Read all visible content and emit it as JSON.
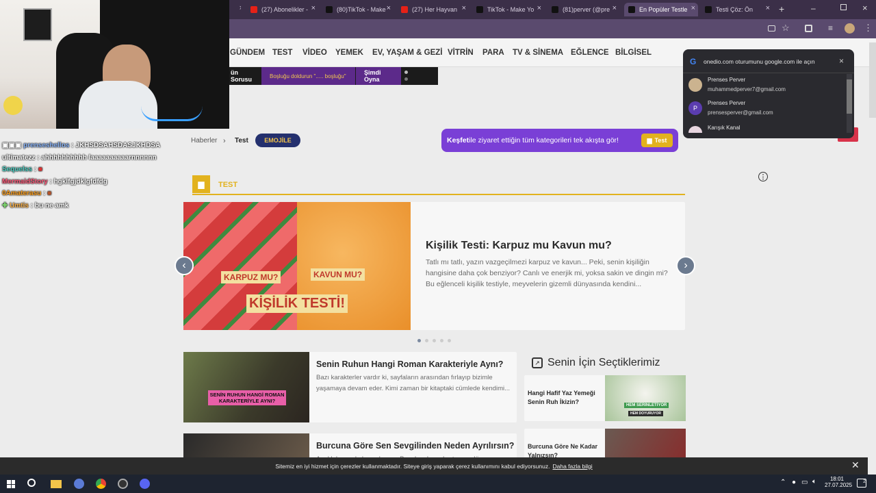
{
  "tabs": [
    {
      "label": "(27) Abonelikler -",
      "icon_color": "#e62117"
    },
    {
      "label": "(80)TikTok - Make",
      "icon_color": "#111111"
    },
    {
      "label": "(27) Her Hayvan",
      "icon_color": "#e62117"
    },
    {
      "label": "TikTok - Make Yo",
      "icon_color": "#111111"
    },
    {
      "label": "(81)perver (@pre",
      "icon_color": "#111111"
    },
    {
      "label": "En Popüler Testle",
      "icon_color": "#111111"
    },
    {
      "label": "Testi Çöz: Ön",
      "icon_color": "#111111"
    }
  ],
  "nav": {
    "items": [
      "GÜNDEM",
      "TEST",
      "VİDEO",
      "YEMEK",
      "EV, YAŞAM & GEZİ",
      "VİTRİN",
      "PARA",
      "TV & SİNEMA",
      "EĞLENCE",
      "BİLGİSEL"
    ]
  },
  "subbar": {
    "item1": "ün Sorusu",
    "item2": "Boşluğu doldurun \"..... boşluğu\"",
    "item3": "Şimdi Oyna"
  },
  "breadcrumb": {
    "home": "Haberler",
    "current": "Test",
    "badge": "EMOJİLE"
  },
  "promo": {
    "bold": "Keşfet",
    "rest": " ile ziyaret ettiğin tüm kategorileri tek akışta gör!",
    "button": "Test"
  },
  "section": {
    "label": "TEST"
  },
  "hero": {
    "title": "Kişilik Testi: Karpuz mu Kavun mu?",
    "desc": "Tatlı mı tatlı, yazın vazgeçilmezi karpuz ve kavun... Peki, senin kişiliğin hangisine daha çok benziyor? Canlı ve enerjik mi, yoksa sakin ve dingin mi? Bu eğlenceli kişilik testiyle, meyvelerin gizemli dünyasında kendini...",
    "img_label_1": "KARPUZ MU?",
    "img_label_2": "KAVUN MU?",
    "img_label_3": "KİŞİLİK TESTİ!"
  },
  "articles": [
    {
      "title": "Senin Ruhun Hangi Roman Karakteriyle Aynı?",
      "desc": "Bazı karakterler vardır ki, sayfaların arasından fırlayıp bizimle yaşamaya devam eder. Kimi zaman bir kitaptaki cümlede kendimi...",
      "img_label": "SENİN RUHUN HANGİ ROMAN KARAKTERİYLE AYNI?"
    },
    {
      "title": "Burcuna Göre Sen Sevgilinden Neden Ayrılırsın?",
      "desc": "Ayrılık kapıyı kolay çalmaz... Bazı kapılar sabır taşına döner...",
      "img_label": ""
    }
  ],
  "picks": {
    "title": "Senin İçin Seçtiklerimiz",
    "items": [
      {
        "title": "Hangi Hafif Yaz Yemeği Senin Ruh İkizin?",
        "img_label_1": "HEM SERİNLETİYOR",
        "img_label_2": "HEM DOYURUYOR"
      },
      {
        "title": "Burcuna Göre Ne Kadar Yalnızsın?"
      }
    ]
  },
  "chat": [
    {
      "user": "prenseshellos",
      "msg": "JKHSDSAHSDASJKHDSA",
      "user_color": "#8ab4f8"
    },
    {
      "user": "ultimatezz",
      "msg": "ahhhhhhhhhh laaaaaaaaaarnnnnnn",
      "user_color": "#ffffff"
    },
    {
      "user": "Sequelss",
      "msg": "",
      "user_color": "#4fd1c5"
    },
    {
      "user": "MermaidStory",
      "msg": "hgklfgjdklgfdfdg",
      "user_color": "#ff5a7a"
    },
    {
      "user": "0Amaterasu",
      "msg": "",
      "user_color": "#ff9f1a"
    },
    {
      "user": "Umtis",
      "msg": "bu ne amk",
      "user_color": "#ffb347"
    }
  ],
  "google_popup": {
    "header": "onedio.com oturumunu google.com ile açın",
    "accounts": [
      {
        "name": "Prenses Perver",
        "email": "muhammedperver7@gmail.com"
      },
      {
        "name": "Prenses Perver",
        "email": "prensesperver@gmail.com",
        "initial": "P"
      },
      {
        "name": "Karışık Kanal",
        "email": ""
      }
    ]
  },
  "cookie": {
    "text": "Sitemiz en iyi hizmet için çerezler kullanmaktadır. Siteye giriş yaparak çerez kullanımını kabul ediyorsunuz.",
    "link": "Daha fazla bilgi"
  },
  "taskbar": {
    "time": "18:01",
    "date": "27.07.2025",
    "notif_count": "2"
  },
  "colors": {
    "accent": "#e2b21e",
    "promo_bg": "#7a3fd6",
    "tab_bg": "#3b2f48",
    "toolbar": "#5a4a6e"
  }
}
